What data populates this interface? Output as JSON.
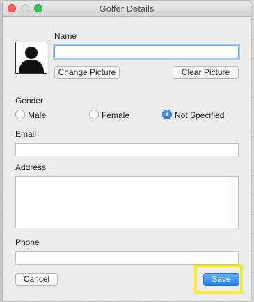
{
  "window": {
    "title": "Golfer Details"
  },
  "form": {
    "name_label": "Name",
    "name_value": "",
    "change_picture_label": "Change Picture",
    "clear_picture_label": "Clear Picture",
    "gender_label": "Gender",
    "gender_options": [
      "Male",
      "Female",
      "Not Specified"
    ],
    "gender_selected": "Not Specified",
    "email_label": "Email",
    "email_value": "",
    "address_label": "Address",
    "address_value": "",
    "phone_label": "Phone",
    "phone_value": ""
  },
  "footer": {
    "cancel_label": "Cancel",
    "save_label": "Save"
  },
  "colors": {
    "accent": "#1e7cf3",
    "highlight": "#f7ef1a"
  },
  "icons": {
    "avatar": "person-silhouette-icon"
  }
}
